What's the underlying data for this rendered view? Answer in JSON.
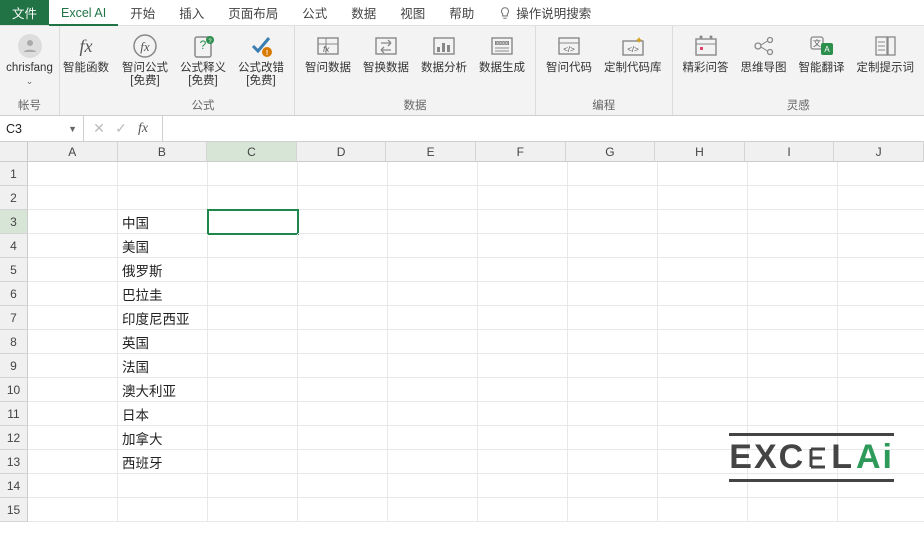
{
  "tabs": {
    "file": "文件",
    "excel_ai": "Excel AI",
    "home": "开始",
    "insert": "插入",
    "layout": "页面布局",
    "formulas": "公式",
    "data": "数据",
    "view": "视图",
    "help": "帮助",
    "tell_me": "操作说明搜索"
  },
  "ribbon": {
    "account": {
      "user": "chrisfang",
      "group_label": "帐号"
    },
    "smart_fn": {
      "btn": "智能函数",
      "group_label": "公式"
    },
    "formula_group": {
      "ask_formula": "智问公式\n[免费]",
      "explain_formula": "公式释义\n[免费]",
      "fix_formula": "公式改错\n[免费]"
    },
    "data_group": {
      "ask_data": "智问数据",
      "swap_data": "智换数据",
      "analyze": "数据分析",
      "generate": "数据生成",
      "label": "数据"
    },
    "code_group": {
      "ask_code": "智问代码",
      "custom_lib": "定制代码库",
      "label": "编程"
    },
    "inspiration_group": {
      "qa": "精彩问答",
      "mindmap": "思维导图",
      "translate": "智能翻译",
      "custom_prompt": "定制提示词",
      "label": "灵感"
    }
  },
  "namebox": {
    "ref": "C3"
  },
  "grid": {
    "columns": [
      "A",
      "B",
      "C",
      "D",
      "E",
      "F",
      "G",
      "H",
      "I",
      "J"
    ],
    "row_count": 15,
    "selected": {
      "col_index": 2,
      "row_index": 2
    },
    "cells": {
      "B3": "中国",
      "B4": "美国",
      "B5": "俄罗斯",
      "B6": "巴拉圭",
      "B7": "印度尼西亚",
      "B8": "英国",
      "B9": "法国",
      "B10": "澳大利亚",
      "B11": "日本",
      "B12": "加拿大",
      "B13": "西班牙"
    }
  },
  "watermark": {
    "text_a": "EXC",
    "text_b": "L",
    "text_ai": "Ai"
  }
}
